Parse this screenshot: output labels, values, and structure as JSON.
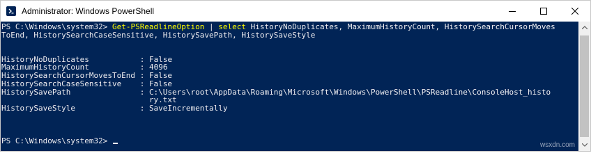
{
  "window": {
    "title": "Administrator: Windows PowerShell",
    "icon": "powershell-icon",
    "controls": [
      "minimize-icon",
      "maximize-icon",
      "close-icon"
    ]
  },
  "console": {
    "prompt": "PS C:\\Windows\\system32>",
    "command": {
      "cmdlet": "Get-PSReadlineOption",
      "pipe": "|",
      "select": "select",
      "args_line1": "HistoryNoDuplicates, MaximumHistoryCount, HistorySearchCursorMoves",
      "args_line2": "ToEnd, HistorySearchCaseSensitive, HistorySavePath, HistorySaveStyle"
    },
    "output": [
      {
        "name": "HistoryNoDuplicates",
        "value": "False"
      },
      {
        "name": "MaximumHistoryCount",
        "value": "4096"
      },
      {
        "name": "HistorySearchCursorMovesToEnd",
        "value": "False"
      },
      {
        "name": "HistorySearchCaseSensitive",
        "value": "False"
      },
      {
        "name": "HistorySavePath",
        "value": "C:\\Users\\root\\AppData\\Roaming\\Microsoft\\Windows\\PowerShell\\PSReadline\\ConsoleHost_histo"
      },
      {
        "name": "",
        "value": "ry.txt"
      },
      {
        "name": "HistorySaveStyle",
        "value": "SaveIncrementally"
      }
    ],
    "separator": ":",
    "final_prompt": "PS C:\\Windows\\system32>"
  },
  "watermark": "wsxdn.com",
  "colors": {
    "console_bg": "#012456",
    "console_fg": "#eeedf0",
    "cmdlet": "#ffff00"
  }
}
